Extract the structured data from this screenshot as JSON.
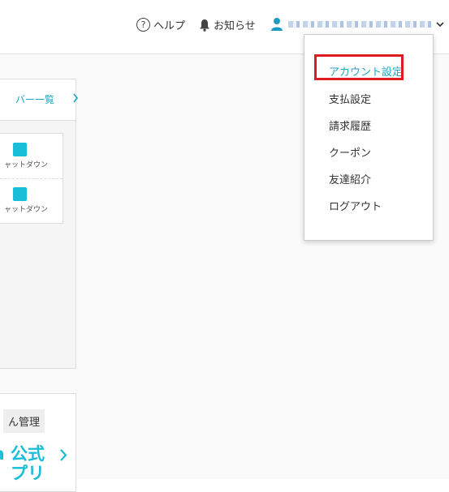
{
  "header": {
    "help_label": "ヘルプ",
    "help_symbol": "?",
    "notice_label": "お知らせ"
  },
  "server_panel": {
    "link_label": "バー一覧",
    "rows": [
      {
        "status": "ャットダウン"
      },
      {
        "status": "ャットダウン"
      }
    ]
  },
  "app_panel": {
    "manage_label": "ん管理",
    "title_line1": "a 公式",
    "title_line2": "プリ"
  },
  "dropdown": {
    "items": [
      {
        "label": "アカウント設定"
      },
      {
        "label": "支払設定"
      },
      {
        "label": "請求履歴"
      },
      {
        "label": "クーポン"
      },
      {
        "label": "友達紹介"
      },
      {
        "label": "ログアウト"
      }
    ]
  },
  "colors": {
    "accent": "#18bdd8",
    "link": "#1aa7c4",
    "highlight": "#e01a22"
  }
}
